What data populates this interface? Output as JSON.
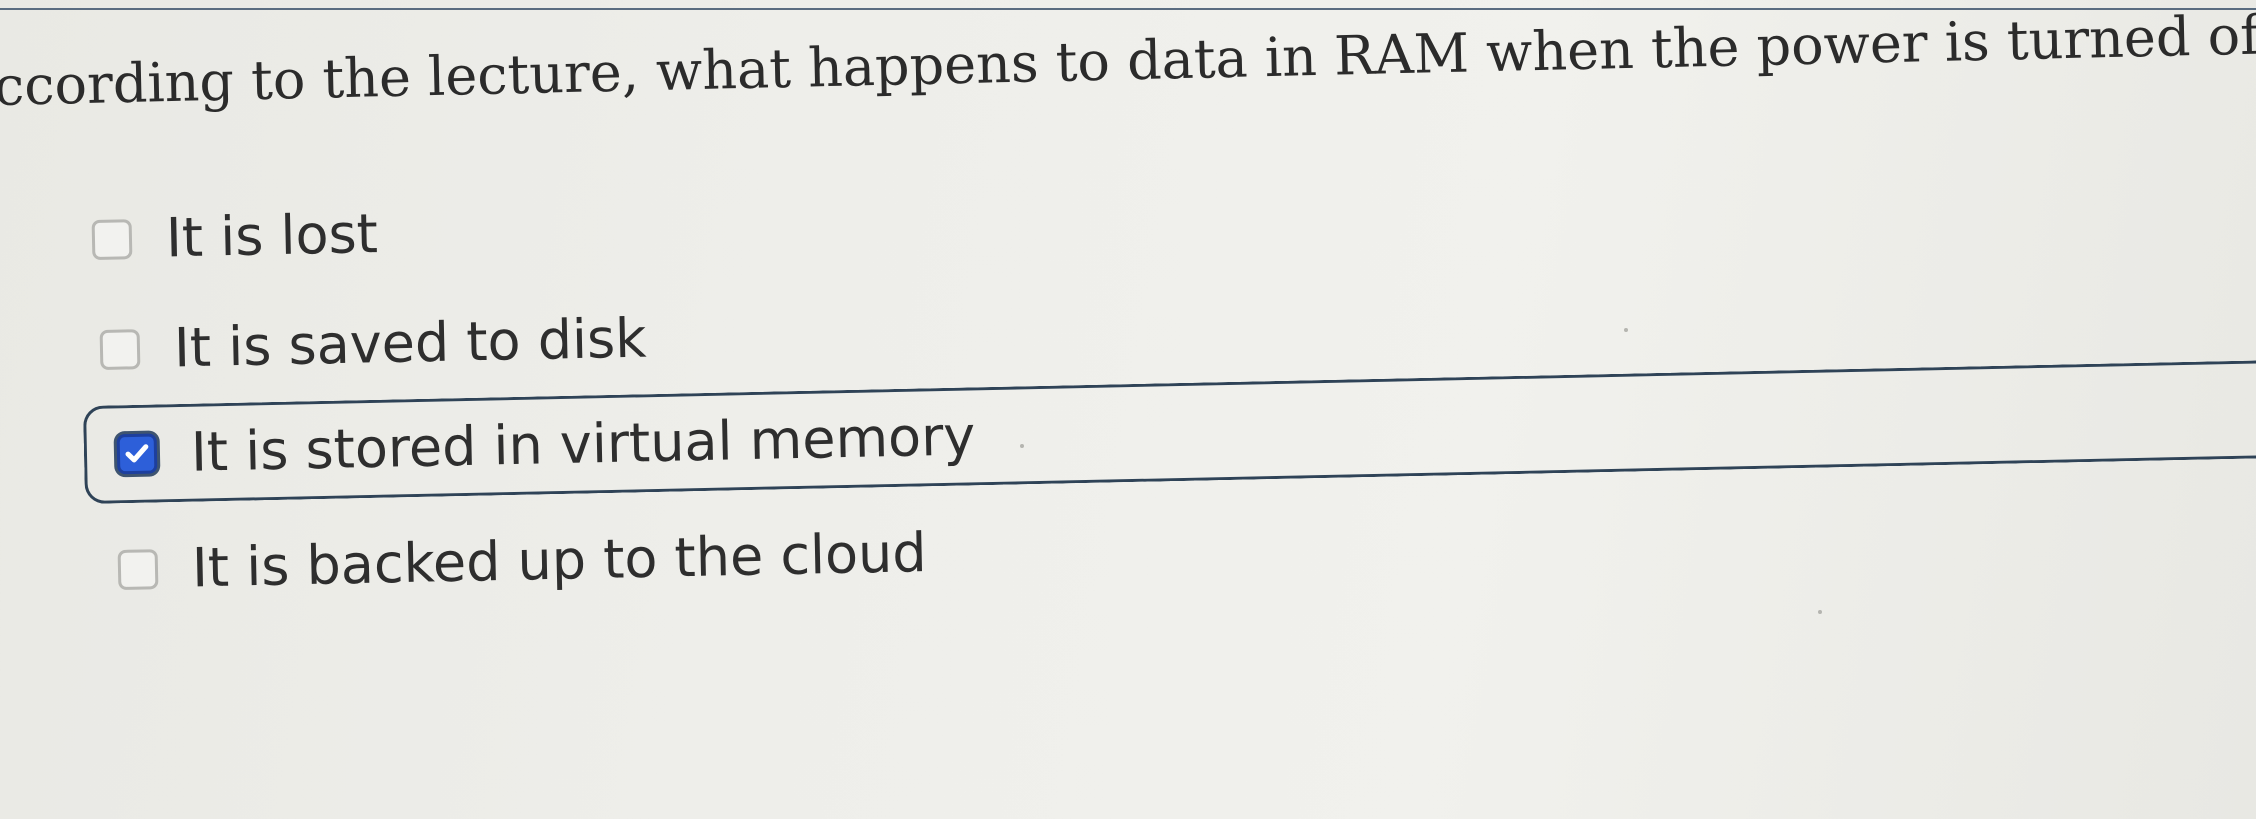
{
  "question": {
    "text": "ccording to the lecture, what happens to data in RAM when the power is turned off?"
  },
  "options": [
    {
      "label": "It is lost",
      "checked": false
    },
    {
      "label": "It is saved to disk",
      "checked": false
    },
    {
      "label": "It is stored in virtual memory",
      "checked": true
    },
    {
      "label": "It is backed up to the cloud",
      "checked": false
    }
  ],
  "colors": {
    "background": "#eeeeea",
    "text": "#2e2e2e",
    "selected_border": "#2f4357",
    "checkbox_checked": "#2d5fd9",
    "checkbox_unchecked_border": "#b8b8b4"
  },
  "icons": {
    "checked": "checkmark-icon",
    "unchecked": "checkbox-empty"
  }
}
